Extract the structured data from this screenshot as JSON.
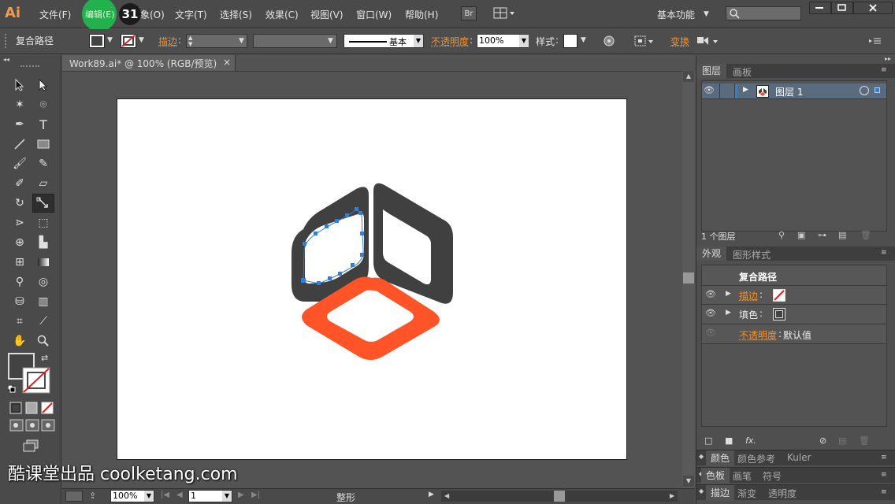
{
  "app": {
    "logo": "Ai",
    "workspace": "基本功能",
    "br": "Br"
  },
  "menus": [
    "文件(F)",
    "编辑(E)",
    "对象(O)",
    "文字(T)",
    "选择(S)",
    "效果(C)",
    "视图(V)",
    "窗口(W)",
    "帮助(H)"
  ],
  "menu_visible": {
    "edit": "编辑(E)",
    "obj_tail": "象(O)"
  },
  "badge": "31",
  "control": {
    "selection": "复合路径",
    "stroke_label": "描边",
    "stroke_style": "基本",
    "opacity_label": "不透明度",
    "opacity_value": "100%",
    "style_label": "样式",
    "transform_label": "变换"
  },
  "doc": {
    "tab_title": "Work89.ai* @ 100% (RGB/预览)",
    "close": "×"
  },
  "status": {
    "zoom": "100%",
    "page": "1",
    "tool": "整形"
  },
  "layers": {
    "tabs": [
      "图层",
      "画板"
    ],
    "layer_name": "图层 1",
    "count": "1 个图层"
  },
  "appearance": {
    "tabs": [
      "外观",
      "图形样式"
    ],
    "title": "复合路径",
    "stroke": "描边",
    "fill": "填色",
    "opacity": "不透明度",
    "opacity_value": "默认值"
  },
  "bottom_panels": [
    [
      "颜色",
      "颜色参考",
      "Kuler"
    ],
    [
      "色板",
      "画笔",
      "符号"
    ],
    [
      "描边",
      "渐变",
      "透明度"
    ]
  ],
  "watermark": "酷课堂出品 coolketang.com",
  "colors": {
    "orange": "#ff5427",
    "dark": "#404040",
    "selection": "#2f7fdc",
    "highlight": "#22b14c"
  }
}
